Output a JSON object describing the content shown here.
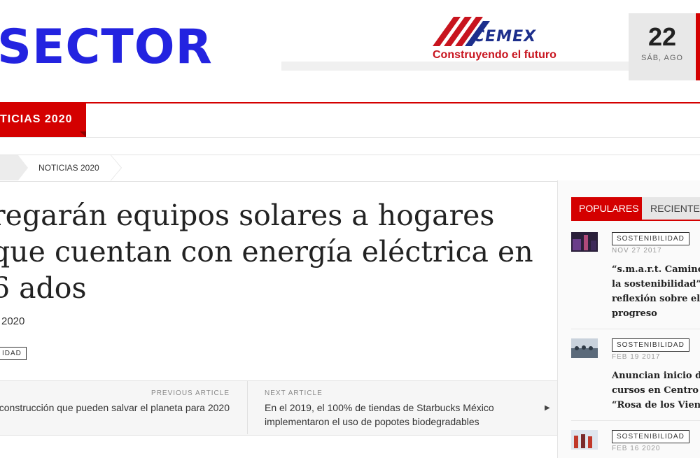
{
  "header": {
    "logo": "SECTOR",
    "ad": {
      "brand": "CEMEX",
      "slogan": "Construyendo el futuro",
      "brand_color": "#1d2f8c",
      "accent_color": "#c8141e"
    },
    "date": {
      "day": "22",
      "weekday_month": "SÁB, AGO"
    }
  },
  "nav": {
    "active_tab": "TICIAS 2020",
    "accent": "#d40000"
  },
  "breadcrumb": {
    "current": "NOTICIAS 2020"
  },
  "article": {
    "title": "regarán equipos solares a hogares que cuentan con energía eléctrica en 6 ados",
    "date": "2020",
    "tag": "IDAD"
  },
  "post_nav": {
    "previous_label": "PREVIOUS ARTICLE",
    "previous_title": "de construcción que pueden salvar el planeta para 2020",
    "next_label": "NEXT ARTICLE",
    "next_title": "En el 2019, el 100% de tiendas de Starbucks México implementaron el uso de popotes biodegradables"
  },
  "sidebar": {
    "tabs": {
      "popular": "POPULARES",
      "recent": "RECIENTES"
    },
    "items": [
      {
        "tag": "SOSTENIBILIDAD",
        "date": "NOV 27 2017",
        "title_lines": [
          "“s.m.a.r.t. Caminos",
          "la sostenibilidad”, u",
          "reflexión sobre el",
          "progreso"
        ]
      },
      {
        "tag": "SOSTENIBILIDAD",
        "date": "FEB 19 2017",
        "title_lines": [
          "Anuncian inicio de",
          "cursos en Centro Cu",
          "“Rosa de los Vientos"
        ]
      },
      {
        "tag": "SOSTENIBILIDAD",
        "date": "FEB 16 2020",
        "title_lines": []
      }
    ]
  }
}
